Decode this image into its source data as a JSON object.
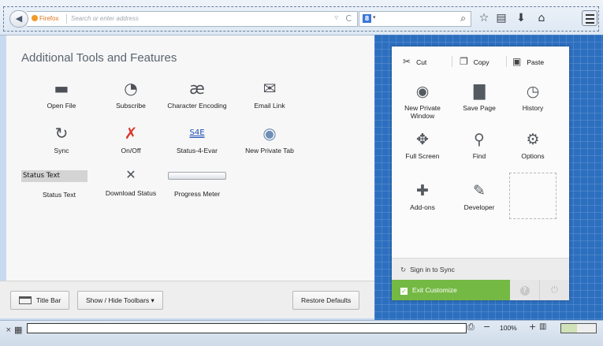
{
  "toolbar": {
    "back_glyph": "◀",
    "identity_label": "Firefox",
    "url_placeholder": "Search or enter address",
    "history_glyph": "▿",
    "reload_glyph": "C",
    "search_engine": "8",
    "search_caret": "▾",
    "search_glyph": "⌕",
    "bookmark_glyph": "☆",
    "reading_glyph": "▤",
    "download_glyph": "⬇",
    "home_glyph": "⌂"
  },
  "palette": {
    "title": "Additional Tools and Features",
    "items": [
      {
        "label": "Open File",
        "glyph": "▬"
      },
      {
        "label": "Subscribe",
        "glyph": "◔"
      },
      {
        "label": "Character Encoding",
        "glyph": "æ"
      },
      {
        "label": "Email Link",
        "glyph": "✉"
      },
      {
        "label": "Sync",
        "glyph": "↻"
      },
      {
        "label": "On/Off",
        "glyph": "✗"
      },
      {
        "label": "Status-4-Evar",
        "glyph": "S4E"
      },
      {
        "label": "New Private Tab",
        "glyph": "◉"
      },
      {
        "label": "Status Text",
        "box": "Status Text"
      },
      {
        "label": "Download Status",
        "glyph": "✕"
      },
      {
        "label": "Progress Meter"
      }
    ]
  },
  "bottombar": {
    "title_bar": "Title Bar",
    "toolbars": "Show / Hide Toolbars ▾",
    "restore": "Restore Defaults"
  },
  "panel": {
    "edit": {
      "cut": "Cut",
      "copy": "Copy",
      "paste": "Paste"
    },
    "items": [
      {
        "label": "New Private Window",
        "glyph": "◉"
      },
      {
        "label": "Save Page",
        "glyph": "▇"
      },
      {
        "label": "History",
        "glyph": "◷"
      },
      {
        "label": "Full Screen",
        "glyph": "✥"
      },
      {
        "label": "Find",
        "glyph": "⚲"
      },
      {
        "label": "Options",
        "glyph": "⚙"
      },
      {
        "label": "Add-ons",
        "glyph": "✚"
      },
      {
        "label": "Developer",
        "glyph": "✎"
      }
    ],
    "sync": "Sign in to Sync",
    "exit": "Exit Customize",
    "help_glyph": "?",
    "quit_glyph": "⏻"
  },
  "statusbar": {
    "close_glyph": "×",
    "zoom": "100%",
    "zoom_out": "−",
    "zoom_in": "+",
    "print_glyph": "⎙"
  }
}
